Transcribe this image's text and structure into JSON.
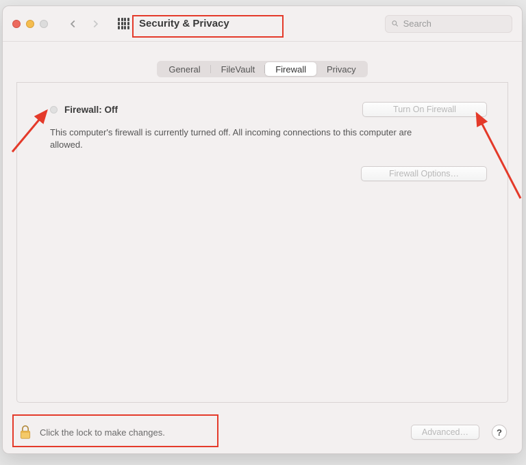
{
  "header": {
    "title": "Security & Privacy",
    "search_placeholder": "Search"
  },
  "tabs": {
    "items": [
      "General",
      "FileVault",
      "Firewall",
      "Privacy"
    ],
    "selected": "Firewall"
  },
  "firewall": {
    "status_label": "Firewall: Off",
    "turn_on_label": "Turn On Firewall",
    "description": "This computer's firewall is currently turned off. All incoming connections to this computer are allowed.",
    "options_label": "Firewall Options…"
  },
  "footer": {
    "lock_text": "Click the lock to make changes.",
    "advanced_label": "Advanced…",
    "help_label": "?"
  }
}
